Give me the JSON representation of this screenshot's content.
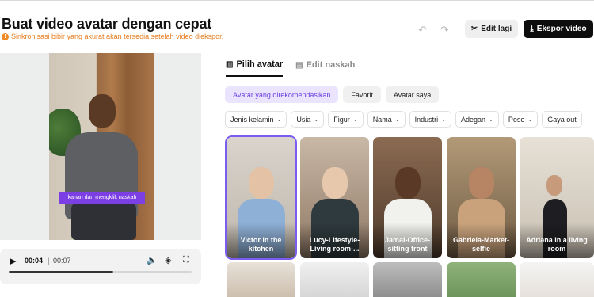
{
  "header": {
    "title": "Buat video avatar dengan cepat",
    "notice": "Sinkronisasi bibir yang akurat akan tersedia setelah video diekspor.",
    "notice_icon": "warning-icon",
    "undo_icon": "undo-icon",
    "redo_icon": "redo-icon",
    "edit_again_label": "Edit lagi",
    "export_label": "Ekspor video"
  },
  "preview": {
    "caption": "kanan dan mengklik naskah"
  },
  "player": {
    "current_time": "00:04",
    "separator": "|",
    "total_time": "00:07",
    "progress": 0.57
  },
  "tabs": [
    {
      "label": "Pilih avatar",
      "active": true
    },
    {
      "label": "Edit naskah",
      "active": false
    }
  ],
  "chips": [
    {
      "label": "Avatar yang direkomendasikan",
      "active": true
    },
    {
      "label": "Favorit",
      "active": false
    },
    {
      "label": "Avatar saya",
      "active": false
    }
  ],
  "filters": [
    "Jenis kelamin",
    "Usia",
    "Figur",
    "Nama",
    "Industri",
    "Adegan",
    "Pose",
    "Gaya out"
  ],
  "avatars": [
    {
      "name": "Victor in the kitchen",
      "selected": true
    },
    {
      "name": "Lucy-Lifestyle-Living room-...",
      "selected": false
    },
    {
      "name": "Jamal-Office-sitting front",
      "selected": false
    },
    {
      "name": "Gabriela-Market-selfie",
      "selected": false
    },
    {
      "name": "Adriana in a living room",
      "selected": false
    }
  ],
  "colors": {
    "accent": "#7b3fe4",
    "accent_soft": "#ebe4ff",
    "warning": "#e87d1e",
    "export_bg": "#0d0d0d"
  }
}
